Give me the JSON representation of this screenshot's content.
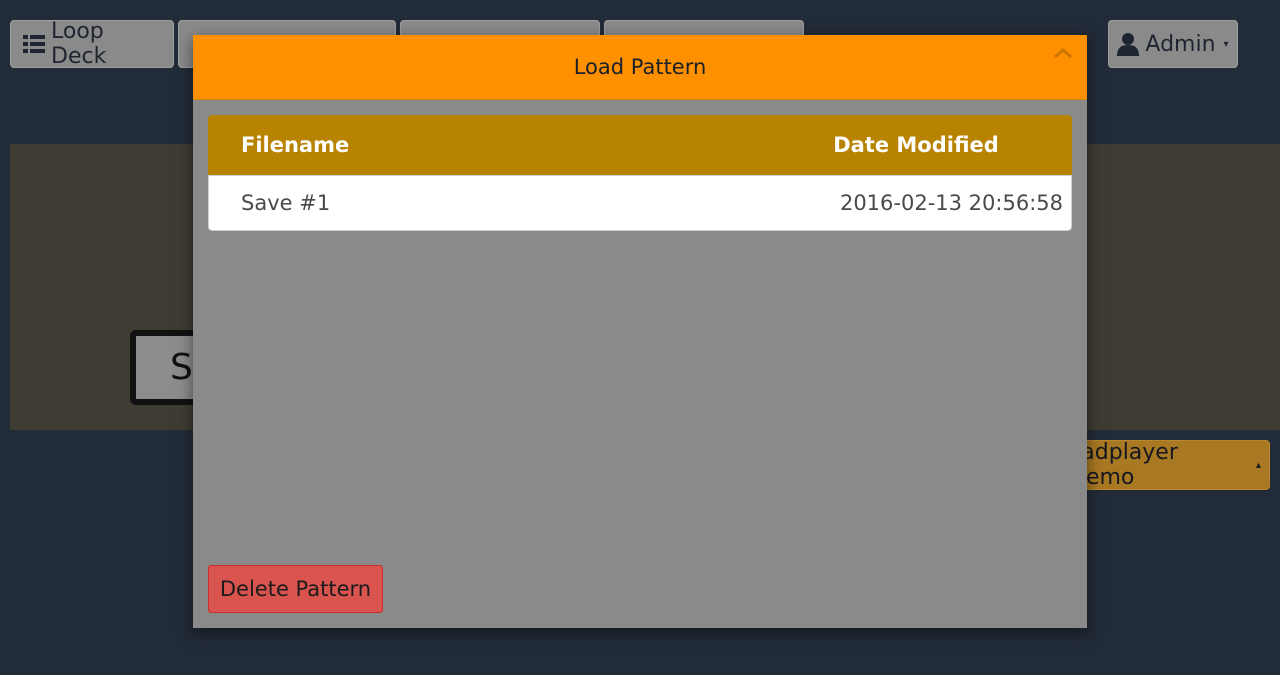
{
  "nav": {
    "loop_deck": "Loop Deck",
    "admin": "Admin",
    "caret": "▾"
  },
  "background": {
    "stop_button_text": "S",
    "padplayer_label": "Padplayer Demo",
    "padplayer_caret": "▴"
  },
  "modal": {
    "title": "Load Pattern",
    "close_glyph": "^",
    "columns": [
      "Filename",
      "Date Modified"
    ],
    "rows": [
      {
        "filename": "Save #1",
        "date_modified": "2016-02-13 20:56:58"
      }
    ],
    "delete_label": "Delete Pattern"
  },
  "colors": {
    "modal_header": "#ff9100",
    "table_header": "#b78300",
    "delete_button": "#d9534f",
    "page_background": "#222b38"
  },
  "icons": {
    "loop_deck": "list-icon",
    "admin": "user-icon"
  }
}
